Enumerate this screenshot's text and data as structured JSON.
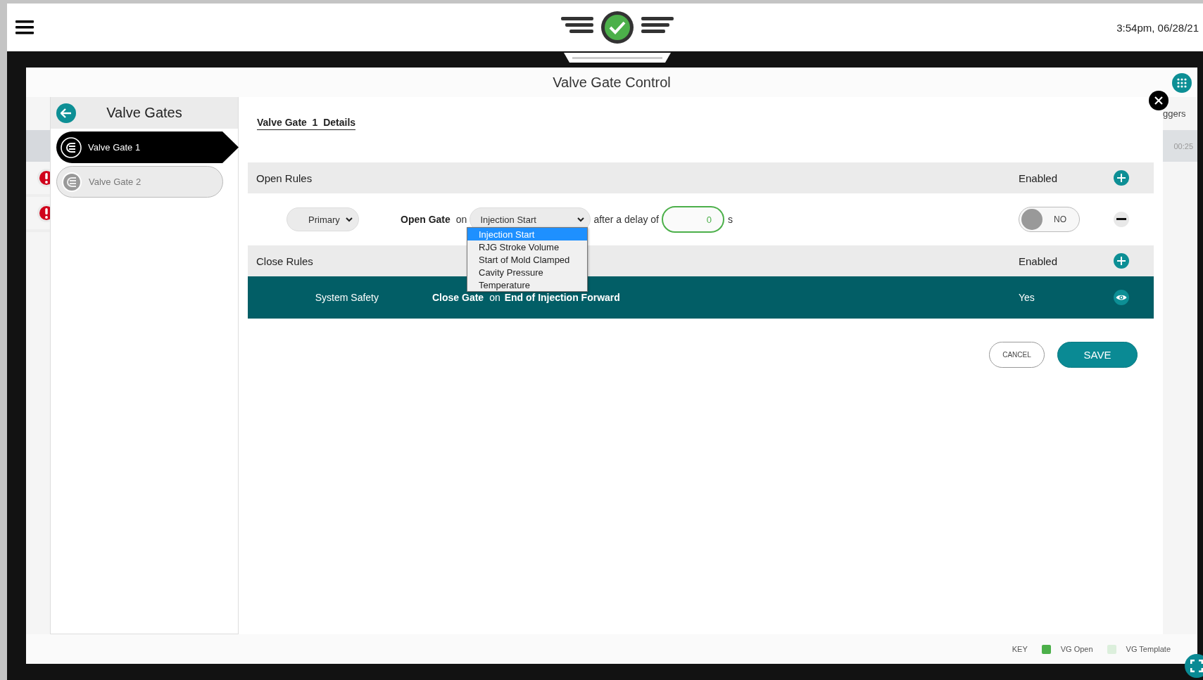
{
  "header": {
    "time": "3:54pm, 06/28/21"
  },
  "modal": {
    "title": "Valve Gate Control"
  },
  "background": {
    "left_rows": [
      {
        "kind": "error"
      },
      {
        "kind": "error"
      }
    ],
    "right_heading": "ggers",
    "right_cell": "00:25"
  },
  "sidebar": {
    "title": "Valve Gates",
    "items": [
      {
        "label": "Valve Gate 1",
        "selected": true
      },
      {
        "label": "Valve Gate 2",
        "selected": false
      }
    ]
  },
  "details_title": "Valve Gate  1  Details",
  "open_rules": {
    "title": "Open Rules",
    "enabled_label": "Enabled",
    "rules": [
      {
        "priority": "Primary",
        "action": "Open Gate",
        "on": "on",
        "trigger": "Injection Start",
        "delay_label": "after a delay of",
        "delay": "0",
        "unit": "s",
        "enabled": false,
        "toggle_label": "NO"
      }
    ]
  },
  "trigger_dropdown": {
    "options": [
      {
        "label": "Injection Start",
        "selected": true
      },
      {
        "label": "RJG Stroke Volume",
        "selected": false
      },
      {
        "label": "Start of Mold Clamped",
        "selected": false
      },
      {
        "label": "Cavity Pressure",
        "selected": false
      },
      {
        "label": "Temperature",
        "selected": false
      }
    ]
  },
  "close_rules": {
    "title": "Close Rules",
    "enabled_label": "Enabled",
    "rules": [
      {
        "name": "System Safety",
        "action": "Close Gate",
        "on": "on",
        "trigger": "End of Injection Forward",
        "enabled_text": "Yes"
      }
    ]
  },
  "buttons": [
    {
      "label": "CANCEL",
      "kind": "secondary"
    },
    {
      "label": "SAVE",
      "kind": "primary"
    }
  ],
  "legend": {
    "title": "KEY",
    "items": [
      {
        "label": "VG Open",
        "color": "#4cb04a"
      },
      {
        "label": "VG Template",
        "color": "#dcefdc"
      }
    ]
  }
}
